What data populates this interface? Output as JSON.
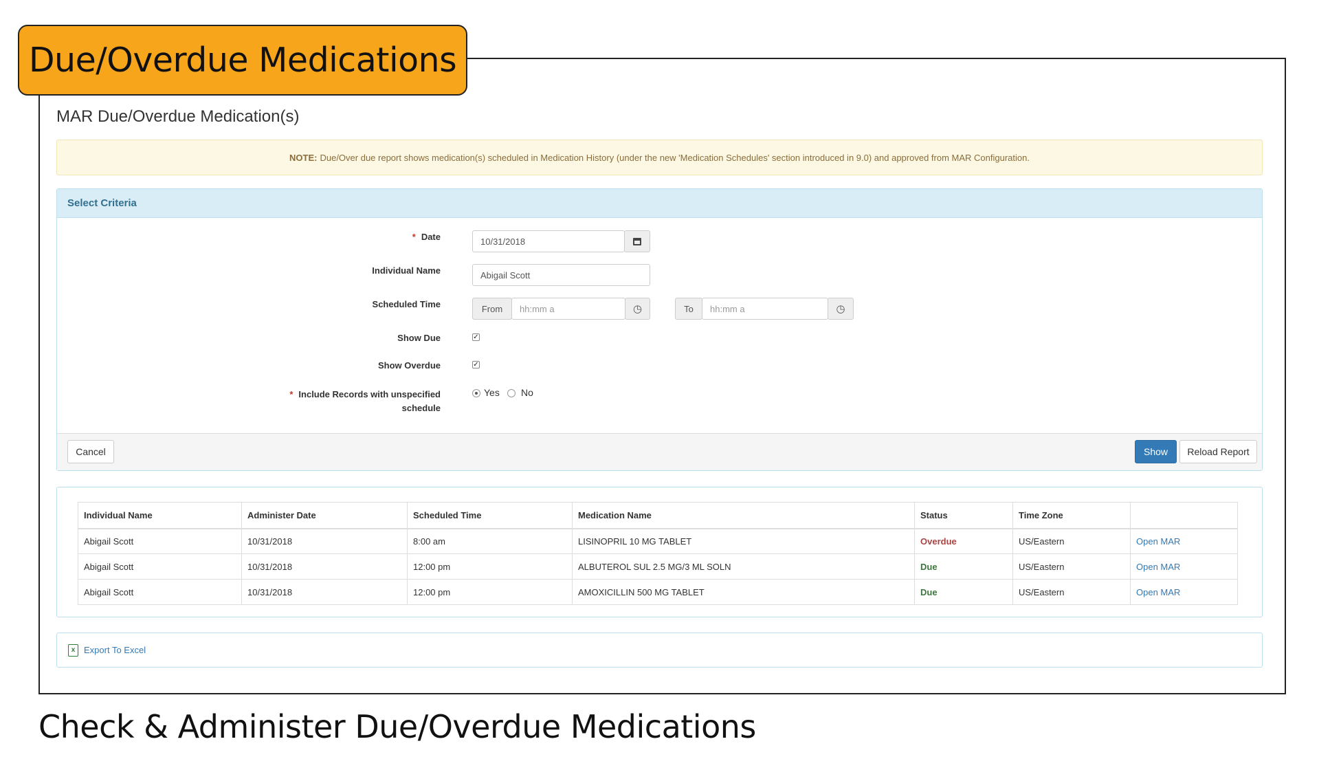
{
  "banner": "Due/Overdue Medications",
  "caption": "Check & Administer Due/Overdue Medications",
  "page_title": "MAR Due/Overdue Medication(s)",
  "note": {
    "label": "NOTE:",
    "text": "Due/Over due report shows medication(s) scheduled in Medication History (under the new 'Medication Schedules' section introduced in 9.0) and approved from MAR Configuration."
  },
  "criteria": {
    "title": "Select Criteria",
    "date_label": "Date",
    "date_value": "10/31/2018",
    "name_label": "Individual Name",
    "name_value": "Abigail Scott",
    "time_label": "Scheduled Time",
    "from_label": "From",
    "from_placeholder": "hh:mm a",
    "to_label": "To",
    "to_placeholder": "hh:mm a",
    "show_due_label": "Show Due",
    "show_due_checked": true,
    "show_overdue_label": "Show Overdue",
    "show_overdue_checked": true,
    "include_label_line1": "Include Records with unspecified",
    "include_label_line2": "schedule",
    "yes_label": "Yes",
    "no_label": "No",
    "include_selected": "Yes",
    "required_mark": "*"
  },
  "buttons": {
    "cancel": "Cancel",
    "show": "Show",
    "reload": "Reload Report"
  },
  "table": {
    "headers": [
      "Individual Name",
      "Administer Date",
      "Scheduled Time",
      "Medication Name",
      "Status",
      "Time Zone",
      ""
    ],
    "rows": [
      {
        "name": "Abigail Scott",
        "date": "10/31/2018",
        "time": "8:00 am",
        "med": "LISINOPRIL 10 MG TABLET",
        "status": "Overdue",
        "tz": "US/Eastern",
        "action": "Open MAR"
      },
      {
        "name": "Abigail Scott",
        "date": "10/31/2018",
        "time": "12:00 pm",
        "med": "ALBUTEROL SUL 2.5 MG/3 ML SOLN",
        "status": "Due",
        "tz": "US/Eastern",
        "action": "Open MAR"
      },
      {
        "name": "Abigail Scott",
        "date": "10/31/2018",
        "time": "12:00 pm",
        "med": "AMOXICILLIN 500 MG TABLET",
        "status": "Due",
        "tz": "US/Eastern",
        "action": "Open MAR"
      }
    ]
  },
  "export_label": "Export To Excel",
  "colors": {
    "banner": "#f7a61c",
    "primary": "#337ab7",
    "overdue": "#a94442",
    "due": "#3c763d"
  }
}
